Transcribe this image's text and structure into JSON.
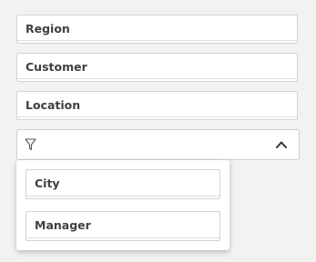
{
  "fields": [
    {
      "label": "Region"
    },
    {
      "label": "Customer"
    },
    {
      "label": "Location"
    }
  ],
  "filter_bar": {
    "icon": "funnel-icon",
    "toggle_icon": "chevron-up-icon"
  },
  "dropdown": {
    "items": [
      {
        "label": "City"
      },
      {
        "label": "Manager"
      }
    ]
  }
}
